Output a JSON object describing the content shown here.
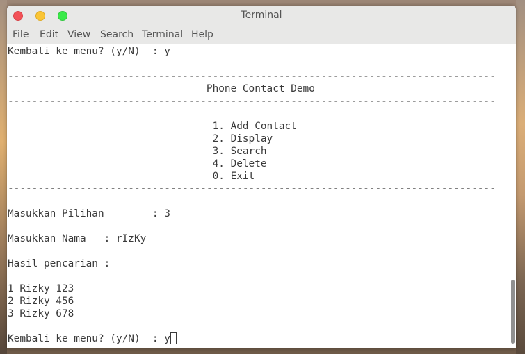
{
  "window": {
    "title": "Terminal"
  },
  "menu": [
    "File",
    "Edit",
    "View",
    "Search",
    "Terminal",
    "Help"
  ],
  "terminal": {
    "lines": [
      "Kembali ke menu? (y/N)  : y",
      "",
      "---------------------------------------------------------------------------------",
      "                                 Phone Contact Demo",
      "---------------------------------------------------------------------------------",
      "",
      "                                  1. Add Contact",
      "                                  2. Display",
      "                                  3. Search",
      "                                  4. Delete",
      "                                  0. Exit",
      "---------------------------------------------------------------------------------",
      "",
      "Masukkan Pilihan        : 3",
      "",
      "Masukkan Nama   : rIzKy",
      "",
      "Hasil pencarian :",
      "",
      "1 Rizky 123",
      "2 Rizky 456",
      "3 Rizky 678",
      "",
      "Kembali ke menu? (y/N)  : y"
    ]
  },
  "colors": {
    "titlebar_bg": "#e8e8e7",
    "terminal_bg": "#ffffff",
    "terminal_fg": "#3a3a3a",
    "close": "#f25056",
    "minimize": "#fac536",
    "maximize": "#39ea49"
  }
}
